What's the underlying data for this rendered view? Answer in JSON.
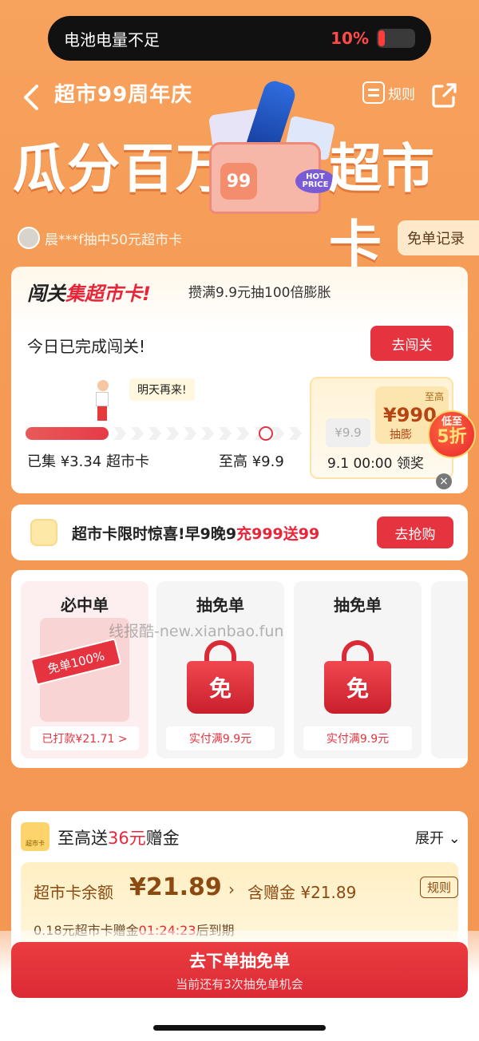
{
  "status": {
    "title": "电池电量不足",
    "percent": "10%",
    "battery_level": 0.1
  },
  "header": {
    "title": "超市99周年庆",
    "rules": "规则",
    "banner_left": "瓜分百万",
    "banner_right": "超市卡",
    "box_logo": "99",
    "hot_price": "HOT PRICE"
  },
  "winner": {
    "text": "晨***f抽中50元超市卡",
    "record_button": "免单记录"
  },
  "challenge": {
    "title_black": "闯关",
    "title_red": "集超市卡!",
    "subtitle": "攒满9.9元抽100倍膨胀",
    "done_text": "今日已完成闯关!",
    "button": "去闯关",
    "bubble": "明天再来!",
    "progress": 0.3378,
    "collected": "已集 ¥3.34 超市卡",
    "max": "至高 ¥9.9",
    "prize_small": "¥9.9",
    "prize_tag": "至高",
    "prize_big": "¥990",
    "prize_label": "抽膨",
    "prize_time": "9.1 00:00 领奖",
    "discount_top": "低至",
    "discount_big": "5折"
  },
  "promo": {
    "text_black": "超市卡限时惊喜!早9晚9",
    "text_red": "充999送99",
    "button": "去抢购"
  },
  "tiles": [
    {
      "title": "必中单",
      "stamp": "免单100%",
      "footer": "已打款¥21.71 >"
    },
    {
      "title": "抽免单",
      "bag": "免",
      "footer": "实付满9.9元"
    },
    {
      "title": "抽免单",
      "bag": "免",
      "footer": "实付满9.9元"
    }
  ],
  "watermark": "线报酷-new.xianbao.fun",
  "bonus": {
    "icon_label": "超市卡",
    "title_a": "至高送",
    "title_red": "36元",
    "title_b": "赠金",
    "expand": "展开 ⌄",
    "balance_label": "超市卡余额",
    "balance_value": "¥21.89",
    "balance_chevron": "›",
    "included": "含赠金 ¥21.89",
    "rules": "规则",
    "expire_a": "0.18元超市卡赠金",
    "expire_red": "01:24:23",
    "expire_b": "后到期"
  },
  "cta": {
    "main": "去下单抽免单",
    "sub": "当前还有3次抽免单机会"
  }
}
